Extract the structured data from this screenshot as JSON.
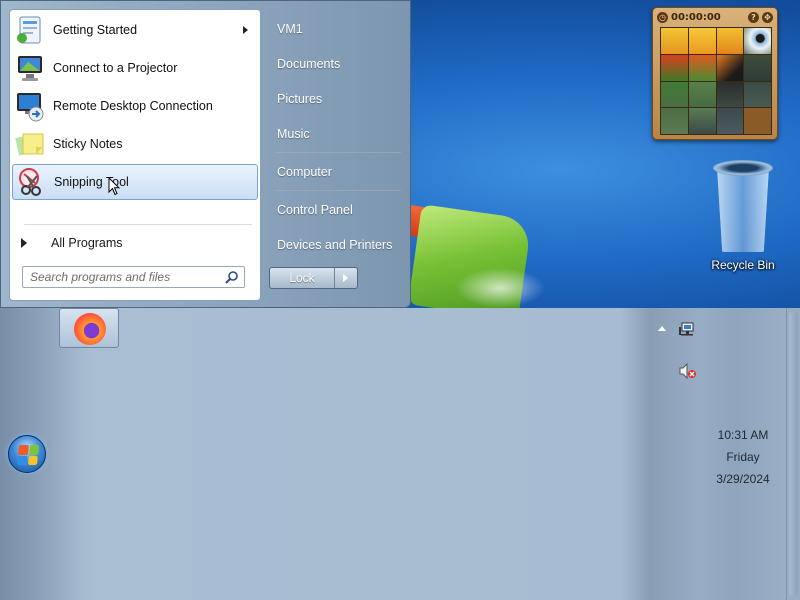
{
  "start_menu": {
    "programs": [
      {
        "label": "Getting Started",
        "has_submenu": true,
        "icon": "getting-started-icon"
      },
      {
        "label": "Connect to a Projector",
        "icon": "projector-icon"
      },
      {
        "label": "Remote Desktop Connection",
        "icon": "remote-desktop-icon"
      },
      {
        "label": "Sticky Notes",
        "icon": "sticky-notes-icon"
      },
      {
        "label": "Snipping Tool",
        "icon": "snipping-tool-icon",
        "selected": true
      }
    ],
    "all_programs": "All Programs",
    "search_placeholder": "Search programs and files",
    "right_items": [
      "VM1",
      "Documents",
      "Pictures",
      "Music",
      "Computer",
      "Control Panel",
      "Devices and Printers"
    ],
    "lock_label": "Lock"
  },
  "gadget": {
    "time": "00:00:00",
    "help": "?"
  },
  "desktop": {
    "recycle_bin_label": "Recycle Bin"
  },
  "taskbar": {
    "time": "10:31 AM",
    "day": "Friday",
    "date": "3/29/2024"
  },
  "colors": {
    "accent": "#1f69c4",
    "selection": "#c9def5"
  }
}
